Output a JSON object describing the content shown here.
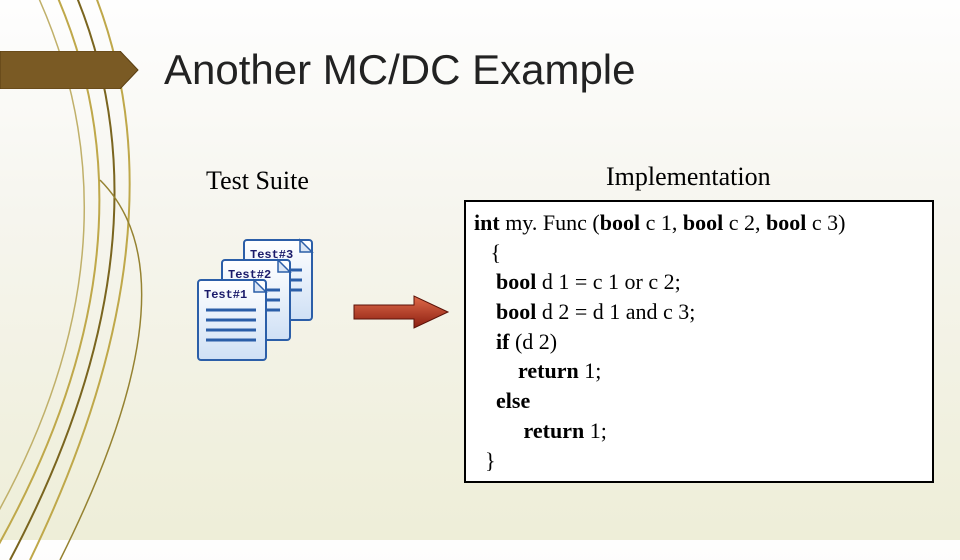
{
  "title": "Another MC/DC Example",
  "testSuiteLabel": "Test Suite",
  "implementationLabel": "Implementation",
  "testIcons": {
    "test1": "Test#1",
    "test2": "Test#2",
    "test3": "Test#3"
  },
  "code": {
    "sig1": "int ",
    "sig2": "my. Func (",
    "sig3": "bool ",
    "sig4": "c 1, ",
    "sig5": "bool ",
    "sig6": "c 2, ",
    "sig7": "bool ",
    "sig8": "c 3)",
    "open": "   {",
    "l1a": "    bool ",
    "l1b": "d 1 = c 1 or c 2;",
    "l2a": "    bool ",
    "l2b": "d 2 = d 1 and c 3;",
    "l3a": "    if ",
    "l3b": "(d 2)",
    "l4a": "        return ",
    "l4b": "1;",
    "l5": "    else",
    "l6a": "         return ",
    "l6b": "1;",
    "close": "  }"
  }
}
